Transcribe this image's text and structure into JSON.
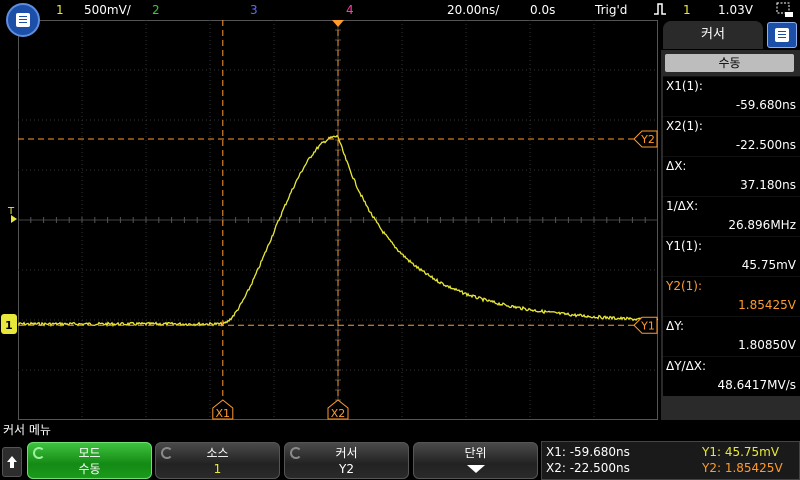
{
  "topbar": {
    "ch1_num": "1",
    "ch1_scale": "500mV/",
    "ch2_num": "2",
    "ch3_num": "3",
    "ch4_num": "4",
    "timebase": "20.00ns/",
    "delay": "0.0s",
    "trigger_status": "Trig'd",
    "trigger_source": "1",
    "trigger_level": "1.03V"
  },
  "graticule": {
    "markers": {
      "trigger": "T",
      "ground": "1",
      "x1": "X1",
      "x2": "X2",
      "y1": "Y1",
      "y2": "Y2"
    },
    "cursor_positions": {
      "x1_div": 3.2,
      "x2_div": 5.0,
      "y1_div": -0.025,
      "y2_div": 3.7
    },
    "waveform": {
      "baseline_div": 0.0,
      "peak_div": 3.75,
      "peak_time_div": 5.0,
      "start_time_div": 3.2
    }
  },
  "sidepanel": {
    "title": "커서",
    "mode": "수동",
    "measurements": [
      {
        "label": "X1(1):",
        "value": "-59.680ns"
      },
      {
        "label": "X2(1):",
        "value": "-22.500ns"
      },
      {
        "label": "ΔX:",
        "value": "37.180ns"
      },
      {
        "label": "1/ΔX:",
        "value": "26.896MHz"
      },
      {
        "label": "Y1(1):",
        "value": "45.75mV"
      },
      {
        "label": "Y2(1):",
        "value": "1.85425V"
      },
      {
        "label": "ΔY:",
        "value": "1.80850V"
      },
      {
        "label": "ΔY/ΔX:",
        "value": "48.6417MV/s"
      }
    ]
  },
  "menu": {
    "title": "커서 메뉴",
    "softkeys": [
      {
        "label": "모드",
        "value": "수동"
      },
      {
        "label": "소스",
        "value": "1"
      },
      {
        "label": "커서",
        "value": "Y2"
      },
      {
        "label": "단위",
        "value": ""
      }
    ]
  },
  "readout": {
    "x1": "X1:  -59.680ns",
    "x2": "X2:  -22.500ns",
    "y1": "Y1: 45.75mV",
    "y2": "Y2: 1.85425V"
  },
  "colors": {
    "ch1": "#e8e83a",
    "ch2": "#22d622",
    "ch3": "#5a6cff",
    "ch4": "#ff3fa3",
    "cursor": "#ff9a2e",
    "grid": "#3a3a3a",
    "accent": "#1c4fa8"
  }
}
